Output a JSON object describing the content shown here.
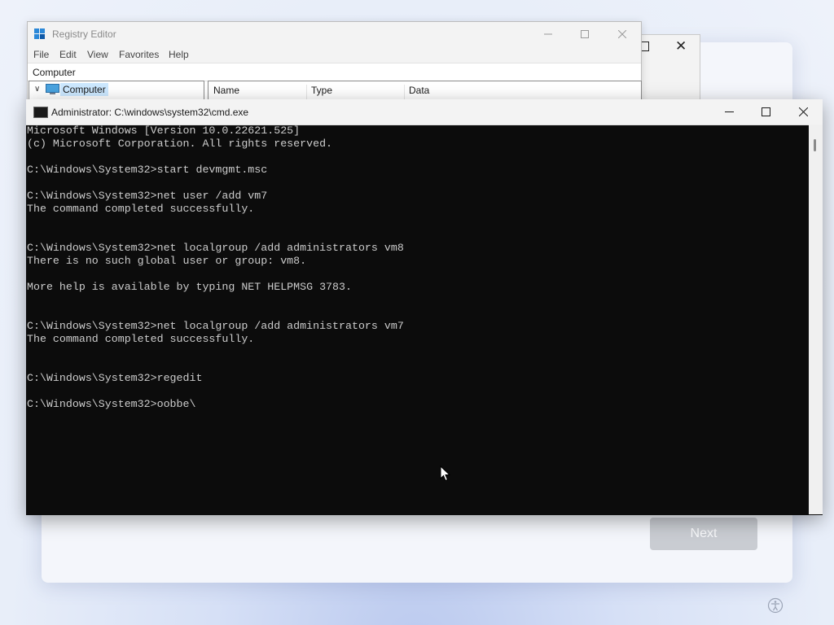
{
  "oobe": {
    "next_label": "Next"
  },
  "regedit": {
    "title": "Registry Editor",
    "menu": [
      "File",
      "Edit",
      "View",
      "Favorites",
      "Help"
    ],
    "address": "Computer",
    "tree_root": "Computer",
    "columns": [
      "Name",
      "Type",
      "Data"
    ]
  },
  "cmd": {
    "title": "Administrator: C:\\windows\\system32\\cmd.exe",
    "lines": [
      "Microsoft Windows [Version 10.0.22621.525]",
      "(c) Microsoft Corporation. All rights reserved.",
      "",
      "C:\\Windows\\System32>start devmgmt.msc",
      "",
      "C:\\Windows\\System32>net user /add vm7",
      "The command completed successfully.",
      "",
      "",
      "C:\\Windows\\System32>net localgroup /add administrators vm8",
      "There is no such global user or group: vm8.",
      "",
      "More help is available by typing NET HELPMSG 3783.",
      "",
      "",
      "C:\\Windows\\System32>net localgroup /add administrators vm7",
      "The command completed successfully.",
      "",
      "",
      "C:\\Windows\\System32>regedit",
      "",
      "C:\\Windows\\System32>oobbe\\"
    ]
  },
  "icons": {
    "accessibility": "accessibility-icon",
    "regedit": "registry-editor-icon",
    "cmd": "command-prompt-icon"
  }
}
